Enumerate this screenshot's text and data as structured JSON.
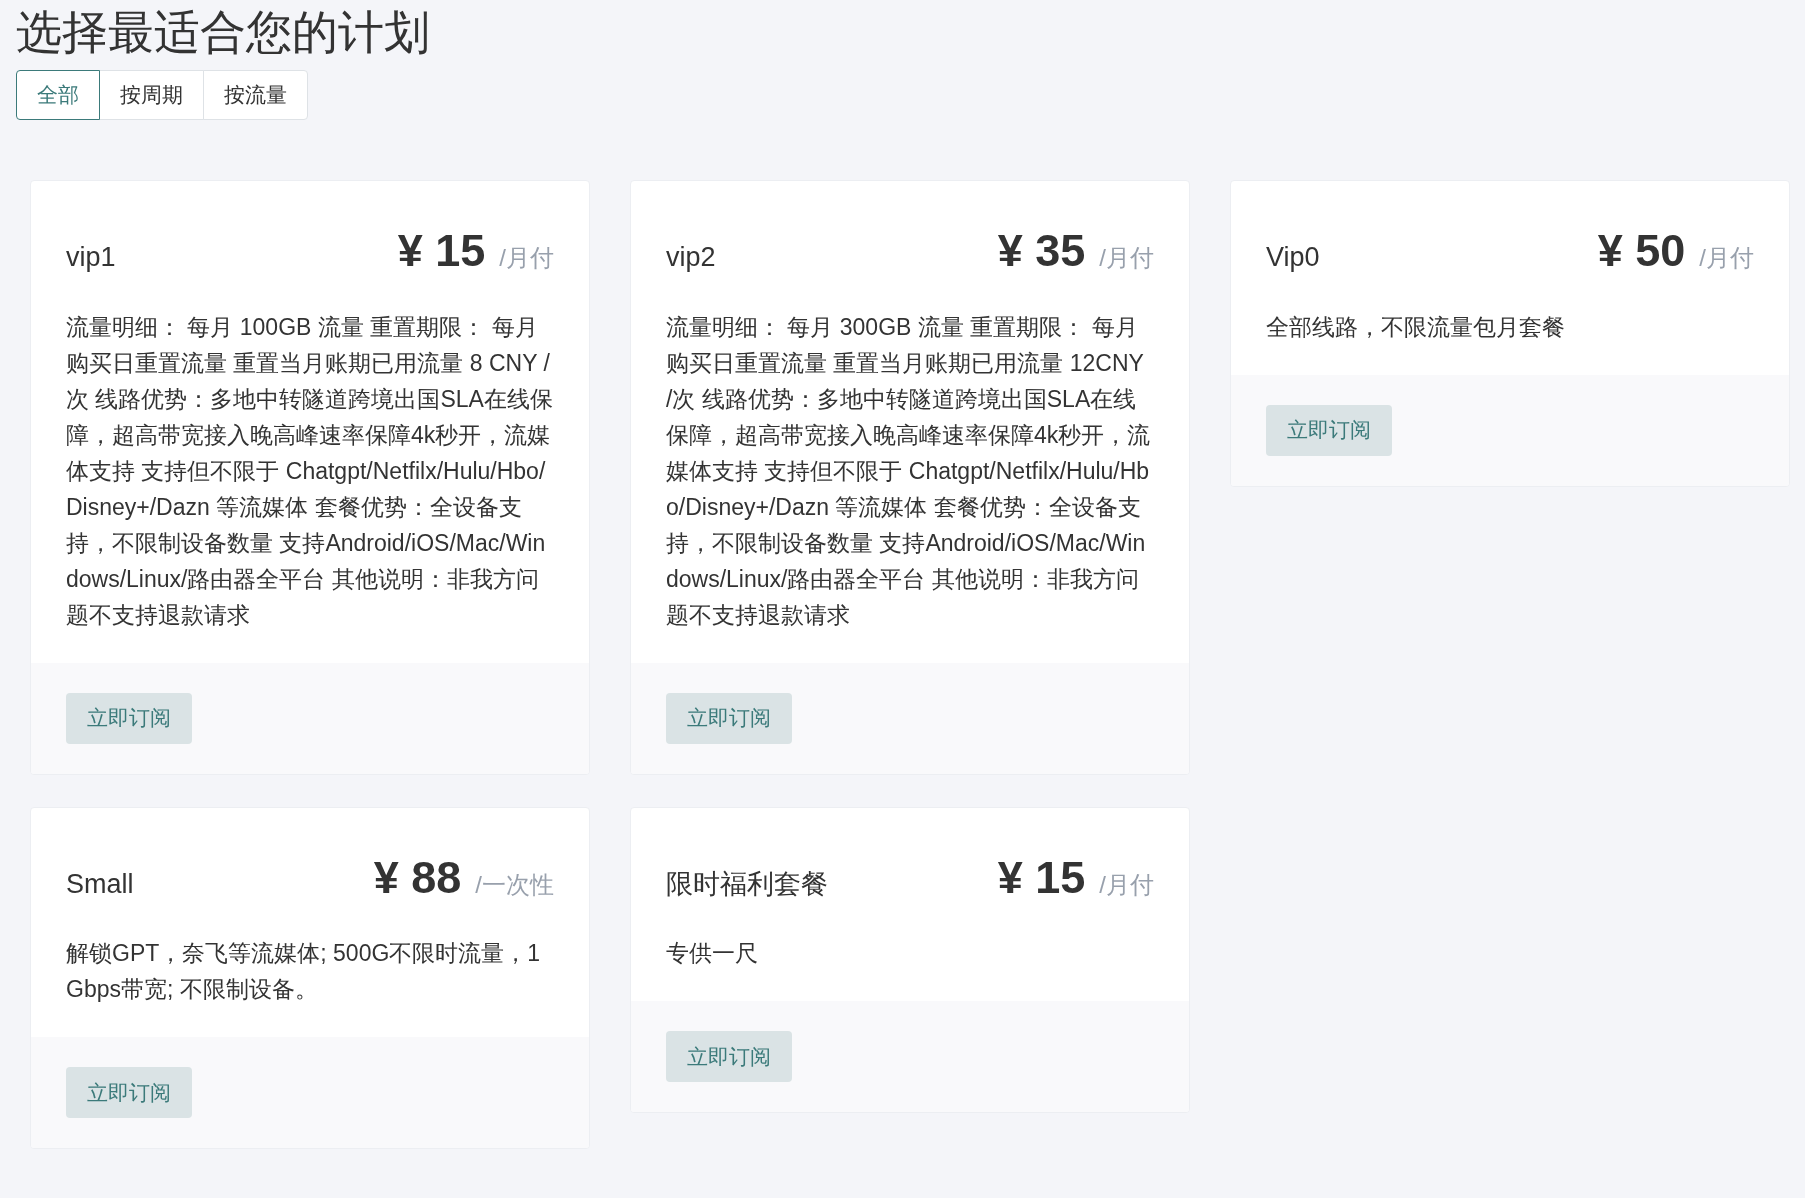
{
  "title": "选择最适合您的计划",
  "tabs": [
    {
      "label": "全部",
      "selected": true
    },
    {
      "label": "按周期",
      "selected": false
    },
    {
      "label": "按流量",
      "selected": false
    }
  ],
  "plans": [
    {
      "name": "vip1",
      "price": "¥ 15",
      "period": "/月付",
      "description": "流量明细： 每月 100GB 流量 重置期限： 每月购买日重置流量 重置当月账期已用流量 8 CNY /次 线路优势：多地中转隧道跨境出国SLA在线保障，超高带宽接入晚高峰速率保障4k秒开，流媒体支持 支持但不限于 Chatgpt/Netfilx/Hulu/Hbo/Disney+/Dazn 等流媒体 套餐优势：全设备支持，不限制设备数量 支持Android/iOS/Mac/Windows/Linux/路由器全平台 其他说明：非我方问题不支持退款请求",
      "button": "立即订阅"
    },
    {
      "name": "vip2",
      "price": "¥ 35",
      "period": "/月付",
      "description": "流量明细： 每月 300GB 流量 重置期限： 每月购买日重置流量 重置当月账期已用流量 12CNY /次 线路优势：多地中转隧道跨境出国SLA在线保障，超高带宽接入晚高峰速率保障4k秒开，流媒体支持 支持但不限于 Chatgpt/Netfilx/Hulu/Hbo/Disney+/Dazn 等流媒体 套餐优势：全设备支持，不限制设备数量 支持Android/iOS/Mac/Windows/Linux/路由器全平台 其他说明：非我方问题不支持退款请求",
      "button": "立即订阅"
    },
    {
      "name": "Vip0",
      "price": "¥ 50",
      "period": "/月付",
      "description": "全部线路，不限流量包月套餐",
      "button": "立即订阅"
    },
    {
      "name": "Small",
      "price": "¥ 88",
      "period": "/一次性",
      "description": "解锁GPT，奈飞等流媒体; 500G不限时流量，1Gbps带宽; 不限制设备。",
      "button": "立即订阅"
    },
    {
      "name": "限时福利套餐",
      "price": "¥ 15",
      "period": "/月付",
      "description": "专供一尺",
      "button": "立即订阅"
    }
  ]
}
